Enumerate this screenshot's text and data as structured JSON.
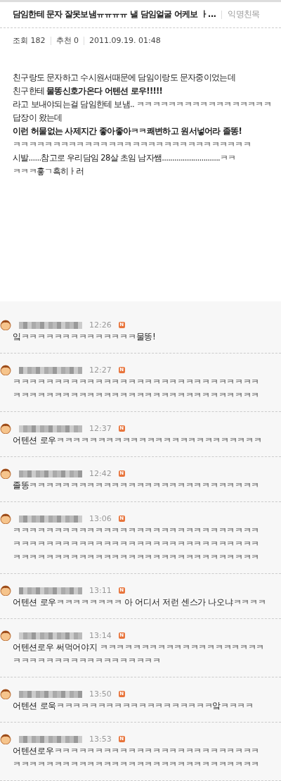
{
  "post": {
    "title": "담임한테 문자 잘못보냄ㅠㅠㅠㅠ 낼 담임얼굴 어케보 ㅏ...",
    "board": "익명친목",
    "meta": [
      {
        "label": "조회",
        "value": "182"
      },
      {
        "label": "추천",
        "value": "0"
      },
      {
        "value": "2011.09.19. 01:48"
      }
    ],
    "body": [
      {
        "text": "친구랑도 문자하고 수시원서때문에 담임이랑도 문자중이었는데",
        "bold": false
      },
      {
        "text": "친구한테 **물똥신호가온다 어텐션 로우!!!!!**",
        "bold": false
      },
      {
        "text": "라고 보내야되는걸 담임한테 보냄.. ㅋㅋㅋㅋㅋㅋㅋㅋㅋㅋㅋㅋㅋㅋㅋㅋㅋ",
        "bold": false
      },
      {
        "text": "답장이 왔는데",
        "bold": false
      },
      {
        "text": "이런 허물없는 사제지간 좋아좋아ㅋㅋ쾌변하고 원서넣어라 졸똥!",
        "bold": true
      },
      {
        "text": "ㅋㅋㅋㅋㅋㅋㅋㅋㅋㅋㅋㅋㅋㅋㅋㅋㅋㅋㅋㅋㅋㅋㅋㅋㅋㅋㅋㅋㅋㅋ",
        "bold": false
      },
      {
        "text": "시발......참고로 우리담임 28살 초임 남자쌤............................ㅋㅋ",
        "bold": false
      },
      {
        "text": "ㅋㅋㅋ흫ㄱ흑히ㅏ러",
        "bold": false
      }
    ]
  },
  "comments": [
    {
      "time": "12:26",
      "badge": "N",
      "lines": [
        "잌ㅋㅋㅋㅋㅋㅋㅋㅋㅋㅋㅋㅋㅋㅋ물똥!"
      ]
    },
    {
      "time": "12:27",
      "badge": "N",
      "lines": [
        "ㅋㅋㅋㅋㅋㅋㅋㅋㅋㅋㅋㅋㅋㅋㅋㅋㅋㅋㅋㅋㅋㅋㅋㅋㅋㅋㅋㅋㅋㅋ",
        "ㅋㅋㅋㅋㅋㅋㅋㅋㅋㅋㅋㅋㅋㅋㅋㅋㅋㅋㅋㅋㅋㅋㅋㅋㅋㅋㅋㅋㅋㅋ"
      ]
    },
    {
      "time": "12:37",
      "badge": "N",
      "lines": [
        "어텐션 로우ㅋㅋㅋㅋㅋㅋㅋㅋㅋㅋㅋㅋㅋㅋㅋㅋㅋㅋㅋㅋㅋㅋㅋㅋㅋ"
      ]
    },
    {
      "time": "12:42",
      "badge": "N",
      "lines": [
        "졸똥ㅋㅋㅋㅋㅋㅋㅋㅋㅋㅋㅋㅋㅋㅋㅋㅋㅋㅋㅋㅋㅋㅋㅋㅋㅋㅋㅋㅋ"
      ]
    },
    {
      "time": "13:06",
      "badge": "N",
      "lines": [
        "ㅋㅋㅋㅋㅋㅋㅋㅋㅋㅋㅋㅋㅋㅋㅋㅋㅋㅋㅋㅋㅋㅋㅋㅋㅋㅋㅋㅋㅋㅋ",
        "ㅋㅋㅋㅋㅋㅋㅋㅋㅋㅋㅋㅋㅋㅋㅋㅋㅋㅋㅋㅋㅋㅋㅋㅋㅋㅋㅋㅋㅋㅋ",
        "ㅋㅋㅋㅋㅋㅋㅋㅋㅋㅋㅋㅋㅋㅋㅋㅋㅋㅋㅋㅋㅋㅋㅋㅋㅋㅋㅋㅋㅋㅋ"
      ]
    },
    {
      "time": "13:11",
      "badge": "N",
      "lines": [
        "어텐션 로우ㅋㅋㅋㅋㅋㅋㅋㅋ 아 어디서 저런 센스가 나오냐ㅋㅋㅋㅋ"
      ]
    },
    {
      "time": "13:14",
      "badge": "N",
      "lines": [
        "어텐션로우 써먹어야지 ㅋㅋㅋㅋㅋㅋㅋㅋㅋㅋㅋㅋㅋㅋㅋㅋㅋㅋㅋㅋ",
        "ㅋㅋㅋㅋㅋㅋㅋㅋㅋㅋㅋㅋㅋㅋㅋㅋㅋㅋ"
      ]
    },
    {
      "time": "13:50",
      "badge": "N",
      "lines": [
        "어텐션 로욱ㅋㅋㅋㅋㅋㅋㅋㅋㅋㅋㅋㅋㅋㅋㅋㅋㅋㅋㅋ앜ㅋㅋㅋㅋ"
      ]
    },
    {
      "time": "13:53",
      "badge": "N",
      "lines": [
        "어텐션로우ㅋㅋㅋㅋㅋㅋㅋㅋㅋㅋㅋㅋㅋㅋㅋㅋㅋㅋㅋㅋㅋㅋㅋㅋㅋ",
        "ㅋㅋㅋㅋㅋㅋㅋㅋㅋㅋㅋㅋㅋㅋㅋㅋㅋㅋㅋㅋㅋㅋㅋㅋㅋㅋㅋㅋㅋㅋ"
      ]
    }
  ]
}
